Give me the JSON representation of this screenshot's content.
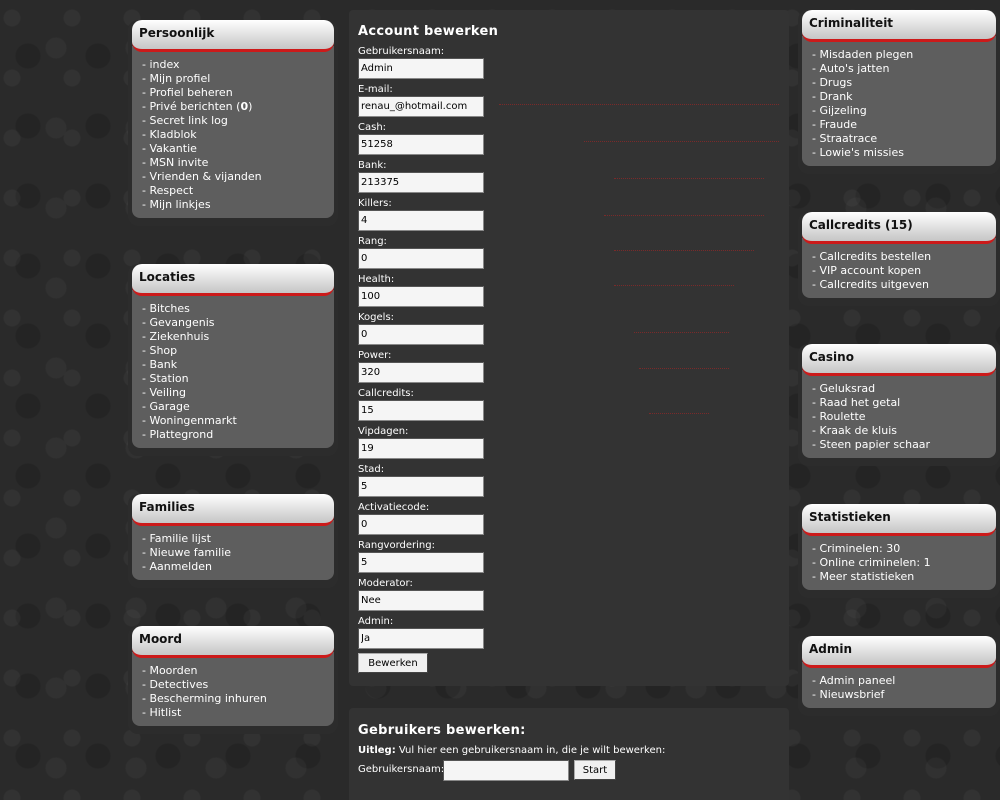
{
  "left_boxes": [
    {
      "title": "Persoonlijk",
      "items": [
        "- index",
        "- Mijn profiel",
        "- Profiel beheren",
        "- Privé berichten (",
        "- Secret link log",
        "- Kladblok",
        "- Vakantie",
        "- MSN invite",
        "- Vrienden & vijanden",
        "- Respect",
        "- Mijn linkjes"
      ],
      "prive_count": "0"
    },
    {
      "title": "Locaties",
      "items": [
        "- Bitches",
        "- Gevangenis",
        "- Ziekenhuis",
        "- Shop",
        "- Bank",
        "- Station",
        "- Veiling",
        "- Garage",
        "- Woningenmarkt",
        "- Plattegrond"
      ]
    },
    {
      "title": "Families",
      "items": [
        "- Familie lijst",
        "- Nieuwe familie",
        "- Aanmelden"
      ]
    },
    {
      "title": "Moord",
      "items": [
        "- Moorden",
        "- Detectives",
        "- Bescherming inhuren",
        "- Hitlist"
      ]
    }
  ],
  "right_boxes": [
    {
      "title": "Criminaliteit",
      "items": [
        "- Misdaden plegen",
        "- Auto's jatten",
        "- Drugs",
        "- Drank",
        "- Gijzeling",
        "- Fraude",
        "- Straatrace",
        "- Lowie's missies"
      ]
    },
    {
      "title": "Callcredits (15)",
      "items": [
        "- Callcredits bestellen",
        "- VIP account kopen",
        "- Callcredits uitgeven"
      ]
    },
    {
      "title": "Casino",
      "items": [
        "- Geluksrad",
        "- Raad het getal",
        "- Roulette",
        "- Kraak de kluis",
        "- Steen papier schaar"
      ]
    },
    {
      "title": "Statistieken",
      "items": [
        "- Criminelen: 30",
        "- Online criminelen: 1",
        "- Meer statistieken"
      ]
    },
    {
      "title": "Admin",
      "items": [
        "- Admin paneel",
        "- Nieuwsbrief"
      ]
    }
  ],
  "account": {
    "title": "Account bewerken",
    "fields": [
      {
        "label": "Gebruikersnaam:",
        "value": "Admin"
      },
      {
        "label": "E-mail:",
        "value": "renau_@hotmail.com"
      },
      {
        "label": "Cash:",
        "value": "51258"
      },
      {
        "label": "Bank:",
        "value": "213375"
      },
      {
        "label": "Killers:",
        "value": "4"
      },
      {
        "label": "Rang:",
        "value": "0"
      },
      {
        "label": "Health:",
        "value": "100"
      },
      {
        "label": "Kogels:",
        "value": "0"
      },
      {
        "label": "Power:",
        "value": "320"
      },
      {
        "label": "Callcredits:",
        "value": "15"
      },
      {
        "label": "Vipdagen:",
        "value": "19"
      },
      {
        "label": "Stad:",
        "value": "5"
      },
      {
        "label": "Activatiecode:",
        "value": "0"
      },
      {
        "label": "Rangvordering:",
        "value": "5"
      },
      {
        "label": "Moderator:",
        "value": "Nee"
      },
      {
        "label": "Admin:",
        "value": "Ja"
      }
    ],
    "submit_label": "Bewerken"
  },
  "users": {
    "title": "Gebruikers bewerken:",
    "note_bold": "Uitleg:",
    "note_text": " Vul hier een gebruikersnaam in, die je wilt bewerken:",
    "field_label": "Gebruikersnaam:",
    "field_value": "",
    "submit_label": "Start"
  },
  "colors": {
    "accent": "#cc1a1a",
    "panel": "#5e5e5e",
    "center": "#333333"
  }
}
